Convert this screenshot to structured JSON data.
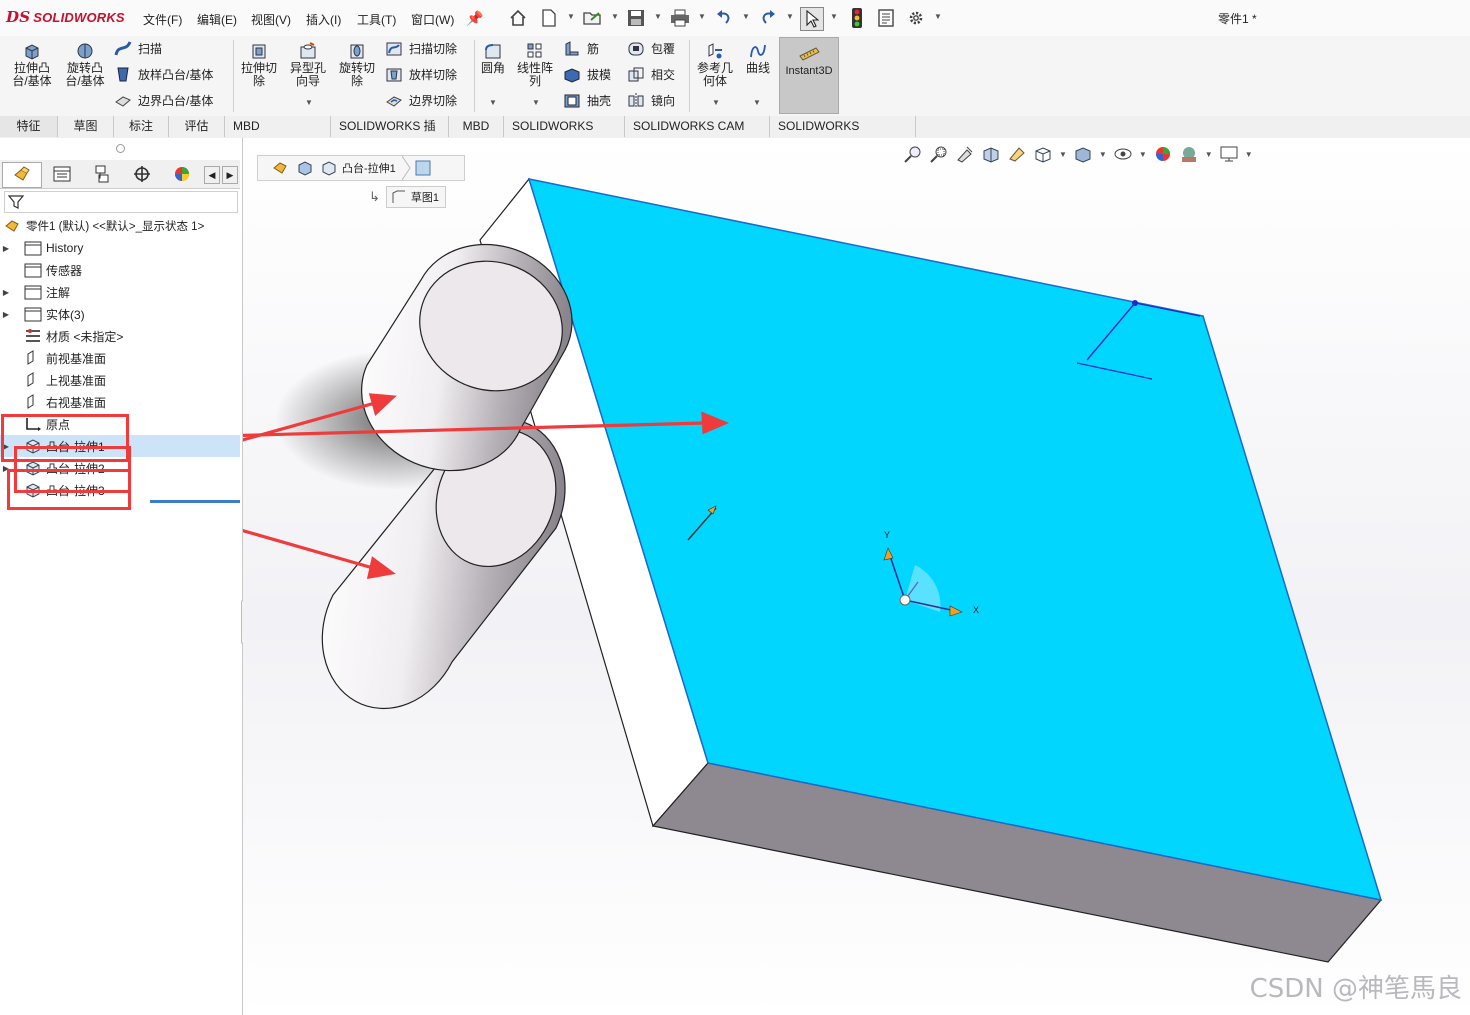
{
  "app": {
    "logo_ds": "DS",
    "logo_text": "SOLIDWORKS",
    "document_title": "零件1 *"
  },
  "menu": [
    {
      "label": "文件(F)"
    },
    {
      "label": "编辑(E)"
    },
    {
      "label": "视图(V)"
    },
    {
      "label": "插入(I)"
    },
    {
      "label": "工具(T)"
    },
    {
      "label": "窗口(W)"
    }
  ],
  "ribbon": {
    "extrude_boss": "拉伸凸\n台/基体",
    "revolve_boss": "旋转凸\n台/基体",
    "sweep": "扫描",
    "loft": "放样凸台/基体",
    "boundary": "边界凸台/基体",
    "extrude_cut": "拉伸切\n除",
    "hole_wizard": "异型孔\n向导",
    "revolve_cut": "旋转切\n除",
    "swept_cut": "扫描切除",
    "lofted_cut": "放样切除",
    "boundary_cut": "边界切除",
    "fillet": "圆角",
    "linear_pattern": "线性阵\n列",
    "rib": "筋",
    "draft": "拔模",
    "shell": "抽壳",
    "wrap": "包覆",
    "intersect": "相交",
    "mirror": "镜向",
    "ref_geometry": "参考几\n何体",
    "curves": "曲线",
    "instant3d": "Instant3D"
  },
  "tabs": [
    {
      "label": "特征"
    },
    {
      "label": "草图"
    },
    {
      "label": "标注"
    },
    {
      "label": "评估"
    },
    {
      "label": "MBD Dimensions"
    },
    {
      "label": "SOLIDWORKS 插件"
    },
    {
      "label": "MBD"
    },
    {
      "label": "SOLIDWORKS CAM"
    },
    {
      "label": "SOLIDWORKS CAM TBM"
    },
    {
      "label": "SOLIDWORKS Inspection"
    }
  ],
  "tree": {
    "root": "零件1 (默认) <<默认>_显示状态 1>",
    "items": [
      {
        "label": "History"
      },
      {
        "label": "传感器"
      },
      {
        "label": "注解"
      },
      {
        "label": "实体(3)"
      },
      {
        "label": "材质 <未指定>"
      },
      {
        "label": "前视基准面"
      },
      {
        "label": "上视基准面"
      },
      {
        "label": "右视基准面"
      },
      {
        "label": "原点"
      },
      {
        "label": "凸台-拉伸1"
      },
      {
        "label": "凸台-拉伸2"
      },
      {
        "label": "凸台-拉伸3"
      }
    ]
  },
  "breadcrumb": {
    "feature": "凸台-拉伸1",
    "sketch": "草图1"
  },
  "axes": {
    "x": "X",
    "y": "Y"
  },
  "watermark": "CSDN @神笔馬良",
  "colors": {
    "face_selected": "#00d6ff",
    "annotation_red": "#ef3b3b",
    "cylinder_top": "#ece8ec",
    "block_side": "#8e8890"
  }
}
